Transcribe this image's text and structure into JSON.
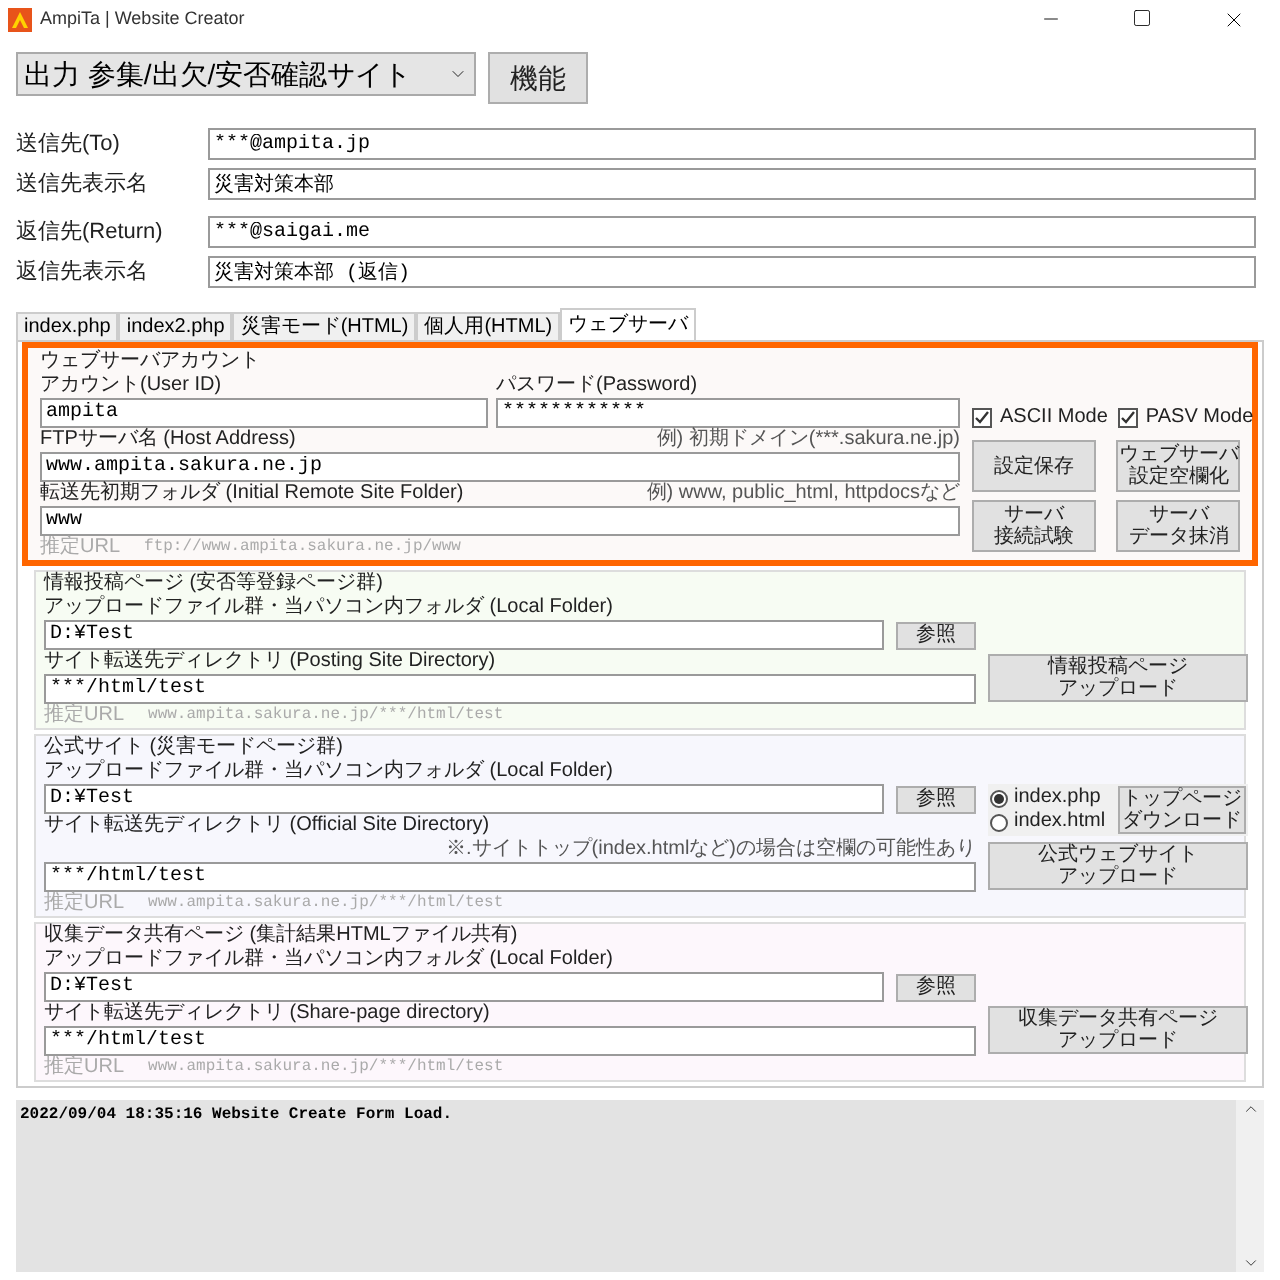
{
  "window": {
    "title": "AmpiTa | Website Creator"
  },
  "selector": {
    "value": "出力 参集/出欠/安否確認サイト"
  },
  "function_button": "機能",
  "mail_groups": [
    [
      {
        "label": "送信先(To)",
        "value": "***@ampita.jp"
      },
      {
        "label": "送信先表示名",
        "value": "災害対策本部"
      }
    ],
    [
      {
        "label": "返信先(Return)",
        "value": "***@saigai.me"
      },
      {
        "label": "返信先表示名",
        "value": "災害対策本部 (返信)"
      }
    ]
  ],
  "tabs": [
    {
      "label": "index.php",
      "selected": false
    },
    {
      "label": "index2.php",
      "selected": false
    },
    {
      "label": "災害モード(HTML)",
      "selected": false
    },
    {
      "label": "個人用(HTML)",
      "selected": false
    },
    {
      "label": "ウェブサーバ",
      "selected": true
    }
  ],
  "server_account": {
    "title": "ウェブサーバアカウント",
    "user_label": "アカウント(User ID)",
    "user_value": "ampita",
    "password_label": "パスワード(Password)",
    "password_value": "************",
    "host_label": "FTPサーバ名 (Host Address)",
    "host_hint": "例) 初期ドメイン(***.sakura.ne.jp)",
    "host_value": "www.ampita.sakura.ne.jp",
    "folder_label": "転送先初期フォルダ (Initial Remote Site Folder)",
    "folder_hint": "例) www, public_html, httpdocsなど",
    "folder_value": "www",
    "url_label": "推定URL",
    "url": "ftp://www.ampita.sakura.ne.jp/www",
    "checkboxes": [
      {
        "label": "ASCII Mode",
        "checked": true
      },
      {
        "label": "PASV Mode",
        "checked": true
      }
    ],
    "buttons": [
      [
        "設定保存"
      ],
      [
        "ウェブサーバ",
        "設定空欄化"
      ],
      [
        "サーバ",
        "接続試験"
      ],
      [
        "サーバ",
        "データ抹消"
      ]
    ]
  },
  "sections": [
    {
      "title": "情報投稿ページ (安否等登録ページ群)",
      "color": "#f7fcf3",
      "local_label": "アップロードファイル群・当パソコン内フォルダ (Local Folder)",
      "local_value": "D:¥Test",
      "browse": "参照",
      "dir_label": "サイト転送先ディレクトリ (Posting Site Directory)",
      "dir_value": "***/html/test",
      "url_label": "推定URL",
      "url": "www.ampita.sakura.ne.jp/***/html/test",
      "upload_button": [
        "情報投稿ページ",
        "アップロード"
      ]
    },
    {
      "title": "公式サイト (災害モードページ群)",
      "color": "#f7f7fd",
      "local_label": "アップロードファイル群・当パソコン内フォルダ (Local Folder)",
      "local_value": "D:¥Test",
      "browse": "参照",
      "dir_label": "サイト転送先ディレクトリ (Official Site Directory)",
      "dir_note": "※.サイトトップ(index.htmlなど)の場合は空欄の可能性あり",
      "dir_value": "***/html/test",
      "url_label": "推定URL",
      "url": "www.ampita.sakura.ne.jp/***/html/test",
      "upload_button": [
        "公式ウェブサイト",
        "アップロード"
      ],
      "radios": [
        {
          "label": "index.php",
          "selected": true
        },
        {
          "label": "index.html",
          "selected": false
        }
      ],
      "download_button": [
        "トップページ",
        "ダウンロード"
      ]
    },
    {
      "title": "収集データ共有ページ (集計結果HTMLファイル共有)",
      "color": "#fdf7fc",
      "local_label": "アップロードファイル群・当パソコン内フォルダ (Local Folder)",
      "local_value": "D:¥Test",
      "browse": "参照",
      "dir_label": "サイト転送先ディレクトリ (Share-page directory)",
      "dir_value": "***/html/test",
      "url_label": "推定URL",
      "url": "www.ampita.sakura.ne.jp/***/html/test",
      "upload_button": [
        "収集データ共有ページ",
        "アップロード"
      ]
    }
  ],
  "log": {
    "text": "2022/09/04 18:35:16 Website Create Form Load."
  }
}
